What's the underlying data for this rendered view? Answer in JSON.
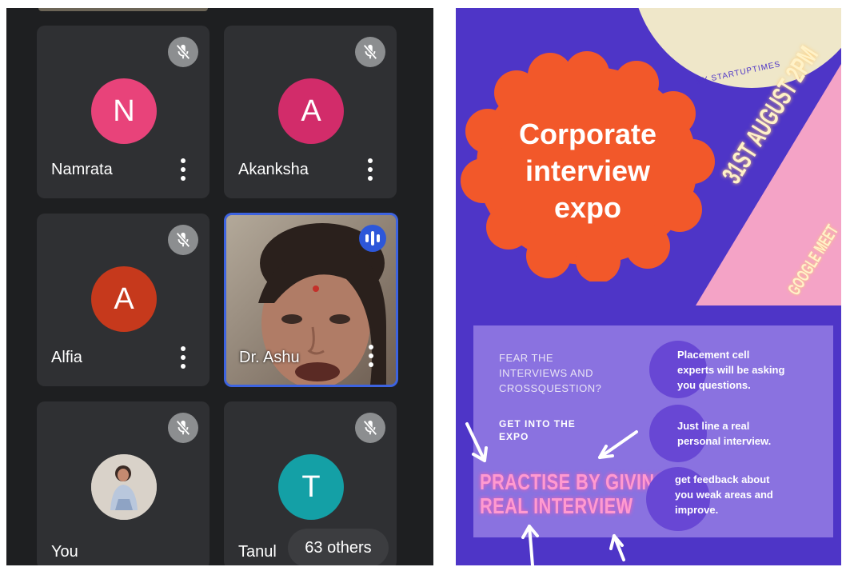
{
  "meeting": {
    "participants": [
      {
        "name": "Namrata",
        "initial": "N",
        "avatar_color": "#e8437a",
        "muted": true
      },
      {
        "name": "Akanksha",
        "initial": "A",
        "avatar_color": "#d22c6a",
        "muted": true
      },
      {
        "name": "Alfia",
        "initial": "A",
        "avatar_color": "#c6391c",
        "muted": true
      },
      {
        "name": "Dr. Ashu",
        "video": true,
        "speaking": true
      },
      {
        "name": "You",
        "photo": true,
        "muted": true
      },
      {
        "name": "Tanul",
        "initial": "T",
        "avatar_color": "#14a0a6",
        "muted": true
      }
    ],
    "others_label": "63 others"
  },
  "poster": {
    "byline": "BY STARTUPTIMES",
    "title_lines": [
      "Corporate",
      "interview",
      "expo"
    ],
    "date": "31ST AUGUST 2PM",
    "platform": "GOOGLE MEET",
    "question_lines": [
      "FEAR THE",
      "INTERVIEWS AND",
      "CROSSQUESTION?"
    ],
    "cta_lines": [
      "GET INTO THE",
      "EXPO"
    ],
    "neon_lines": [
      "PRACTISE BY GIVING",
      "REAL INTERVIEW"
    ],
    "points": [
      {
        "lines": [
          "Placement cell",
          "experts will be asking",
          "you questions."
        ]
      },
      {
        "lines": [
          "Just line a real",
          "personal interview."
        ]
      },
      {
        "lines": [
          "get feedback about",
          "you weak areas and",
          "improve."
        ]
      }
    ],
    "colors": {
      "background": "#4e35c7",
      "badge": "#f2582a",
      "banner": "#f4a3c6",
      "info_panel": "#8a72e0",
      "circle": "#6847d4",
      "cream_circle": "#efe7c9"
    }
  }
}
